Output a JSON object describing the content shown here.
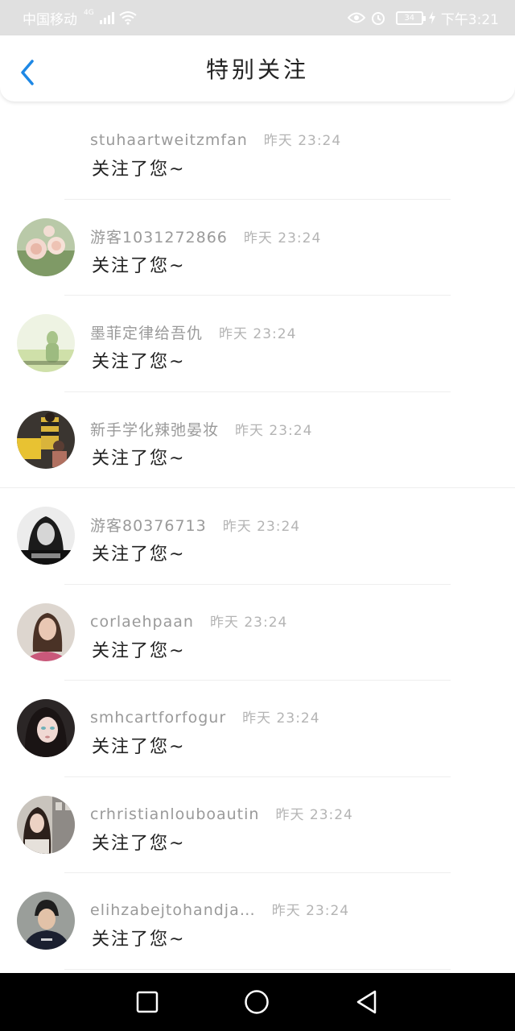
{
  "status_bar": {
    "carrier": "中国移动",
    "network": "4G",
    "battery": "34",
    "time": "下午3:21"
  },
  "header": {
    "title": "特别关注",
    "back_icon": "chevron-left-icon",
    "accent_color": "#1e88e5"
  },
  "items": [
    {
      "name": "stuhaartweitzmfan",
      "time": "昨天 23:24",
      "action": "关注了您~",
      "avatar": "none"
    },
    {
      "name": "游客1031272866",
      "time": "昨天 23:24",
      "action": "关注了您~",
      "avatar": "roses-photo"
    },
    {
      "name": "墨菲定律给吾仇",
      "time": "昨天 23:24",
      "action": "关注了您~",
      "avatar": "silhouette-photo"
    },
    {
      "name": "新手学化辣弛晏妆",
      "time": "昨天 23:24",
      "action": "关注了您~",
      "avatar": "girl-taxi-photo"
    },
    {
      "name": "游客80376713",
      "time": "昨天 23:24",
      "action": "关注了您~",
      "avatar": "dark-hair-photo"
    },
    {
      "name": "corlaehpaan",
      "time": "昨天 23:24",
      "action": "关注了您~",
      "avatar": "pink-sweater-photo"
    },
    {
      "name": "smhcartforfogur",
      "time": "昨天 23:24",
      "action": "关注了您~",
      "avatar": "girl-portrait-photo"
    },
    {
      "name": "crhristianlouboautin",
      "time": "昨天 23:24",
      "action": "关注了您~",
      "avatar": "street-girl-photo"
    },
    {
      "name": "elihzabejtohandja…",
      "time": "昨天 23:24",
      "action": "关注了您~",
      "avatar": "boy-photo"
    }
  ],
  "nav_bar": {
    "recent_icon": "square-icon",
    "home_icon": "circle-icon",
    "back_icon": "triangle-back-icon"
  }
}
